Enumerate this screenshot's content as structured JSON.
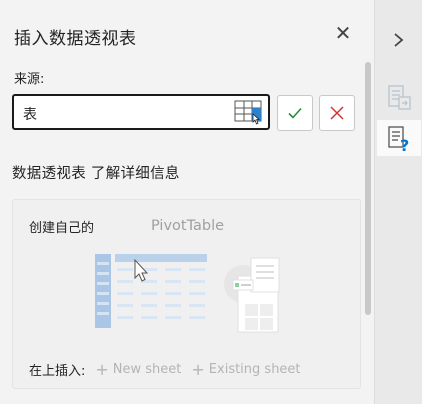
{
  "pane": {
    "title": "插入数据透视表",
    "close_glyph": "✕",
    "source_label": "来源:",
    "source_value": "表",
    "info_text": "数据透视表 了解详细信息",
    "card": {
      "create_label": "创建自己的",
      "pivot_label": "PivotTable",
      "insert_label": "在上插入:",
      "new_sheet": "New sheet",
      "existing_sheet": "Existing sheet"
    }
  },
  "colors": {
    "accept": "#2e8b3e",
    "cancel": "#d13438",
    "accent": "#0078d4"
  },
  "icons": [
    "range-select-icon",
    "checkmark-icon",
    "cancel-x-icon",
    "chevron-right-icon",
    "field-list-icon",
    "pivot-help-icon",
    "close-icon"
  ]
}
